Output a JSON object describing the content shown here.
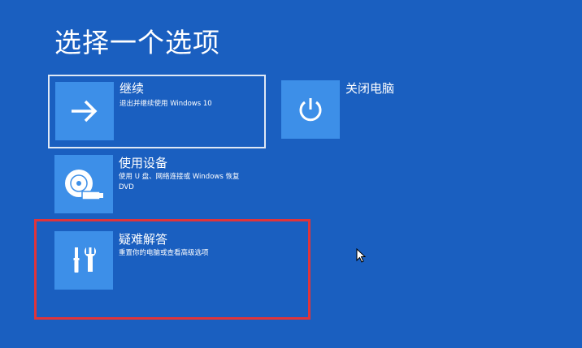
{
  "page": {
    "title": "选择一个选项"
  },
  "options": {
    "continue": {
      "title": "继续",
      "description": "退出并继续使用 Windows 10",
      "icon": "arrow-right-icon"
    },
    "shutdown": {
      "title": "关闭电脑",
      "icon": "power-icon"
    },
    "use_device": {
      "title": "使用设备",
      "description": "使用 U 盘、网络连接或 Windows 恢复 DVD",
      "icon": "disc-drive-icon"
    },
    "troubleshoot": {
      "title": "疑难解答",
      "description": "重置你的电脑或查看高级选项",
      "icon": "tools-icon"
    }
  },
  "colors": {
    "background": "#1a5fc0",
    "tile": "#3d8fe8",
    "highlight": "#e0343a",
    "focus_border": "#dfe8f5"
  }
}
